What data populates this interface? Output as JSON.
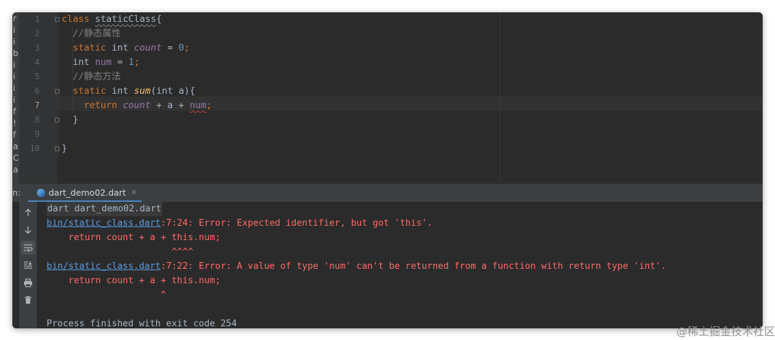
{
  "editor": {
    "line_numbers": [
      "1",
      "2",
      "3",
      "4",
      "5",
      "6",
      "7",
      "8",
      "9",
      "10"
    ],
    "project_strip_glyphs": [
      "r",
      "i",
      "i",
      "b",
      "i",
      "i",
      "i",
      "i",
      "f",
      "!",
      "f",
      "a",
      "C",
      "a"
    ],
    "lines": [
      {
        "tokens": [
          {
            "c": "kw",
            "t": "class "
          },
          {
            "c": "type squiggle-grey",
            "t": "staticClass"
          },
          {
            "c": "type",
            "t": "{"
          }
        ]
      },
      {
        "tokens": [
          {
            "c": "cmt",
            "t": "  //静态属性"
          }
        ]
      },
      {
        "tokens": [
          {
            "c": "kw",
            "t": "  static "
          },
          {
            "c": "type",
            "t": "int "
          },
          {
            "c": "static-field",
            "t": "count"
          },
          {
            "c": "type",
            "t": " = "
          },
          {
            "c": "num",
            "t": "0"
          },
          {
            "c": "kw",
            "t": ";"
          }
        ]
      },
      {
        "tokens": [
          {
            "c": "type",
            "t": "  int "
          },
          {
            "c": "field",
            "t": "num"
          },
          {
            "c": "type",
            "t": " = "
          },
          {
            "c": "num",
            "t": "1"
          },
          {
            "c": "kw",
            "t": ";"
          }
        ]
      },
      {
        "tokens": [
          {
            "c": "cmt",
            "t": "  //静态方法"
          }
        ]
      },
      {
        "tokens": [
          {
            "c": "kw",
            "t": "  static "
          },
          {
            "c": "type",
            "t": "int "
          },
          {
            "c": "fn",
            "t": "sum"
          },
          {
            "c": "type",
            "t": "(int a){"
          }
        ]
      },
      {
        "tokens": [
          {
            "c": "kw",
            "t": "    return "
          },
          {
            "c": "static-field",
            "t": "count"
          },
          {
            "c": "type",
            "t": " + a + "
          },
          {
            "c": "field squiggle",
            "t": "num"
          },
          {
            "c": "kw",
            "t": ";"
          }
        ]
      },
      {
        "tokens": [
          {
            "c": "type",
            "t": "  }"
          }
        ]
      },
      {
        "tokens": []
      },
      {
        "tokens": [
          {
            "c": "type",
            "t": "}"
          }
        ]
      }
    ]
  },
  "run_panel": {
    "label": "n:",
    "tab_title": "dart_demo02.dart",
    "tab_close": "×"
  },
  "toolbar_icons": [
    "arrow-up-icon",
    "arrow-down-icon",
    "soft-wrap-icon",
    "scroll-to-end-icon",
    "print-icon",
    "trash-icon"
  ],
  "console": {
    "command": "dart dart_demo02.dart",
    "error1": {
      "link": "bin/static_class.dart",
      "message": ":7:24: Error: Expected identifier, but got 'this'."
    },
    "error1_code": "    return count + a + this.num;",
    "error1_caret": "                       ^^^^",
    "error2": {
      "link": "bin/static_class.dart",
      "message": ":7:22: Error: A value of type 'num' can't be returned from a function with return type 'int'."
    },
    "error2_code": "    return count + a + this.num;",
    "error2_caret": "                     ^",
    "exit": "Process finished with exit code 254"
  },
  "watermark": "@稀土掘金技术社区",
  "colors": {
    "editor_bg": "#2b2b2b",
    "keyword": "#cc7832",
    "field": "#9876aa",
    "function": "#ffc66d",
    "number": "#6897bb",
    "error": "#ff6b68",
    "link": "#5c9ce6",
    "tab_underline": "#4a88c7"
  }
}
